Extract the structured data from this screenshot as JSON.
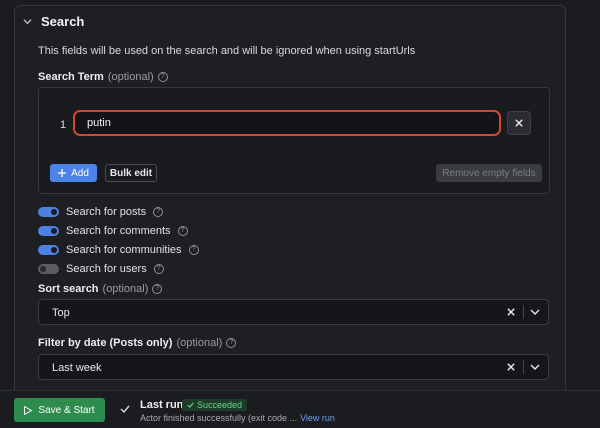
{
  "section": {
    "title": "Search",
    "description": "This fields will be used on the search and will be ignored when using startUrls"
  },
  "search_term": {
    "label": "Search Term",
    "optional": "(optional)",
    "rows": [
      {
        "index": "1",
        "value": "putin"
      }
    ],
    "add_label": "Add",
    "bulk_edit_label": "Bulk edit",
    "remove_empty_label": "Remove empty fields"
  },
  "toggles": [
    {
      "label": "Search for posts",
      "on": true
    },
    {
      "label": "Search for comments",
      "on": true
    },
    {
      "label": "Search for communities",
      "on": true
    },
    {
      "label": "Search for users",
      "on": false
    }
  ],
  "sort": {
    "label": "Sort search",
    "optional": "(optional)",
    "value": "Top"
  },
  "filter": {
    "label": "Filter by date (Posts only)",
    "optional": "(optional)",
    "value": "Last week"
  },
  "footer": {
    "save_label": "Save & Start",
    "last_run_title": "Last run",
    "status_badge": "Succeeded",
    "status_text": "Actor finished successfully (exit code ...",
    "view_run": "View run"
  },
  "colors": {
    "accent": "#4d82e8",
    "success": "#2e8c4e",
    "input_border": "#d4492b"
  },
  "icons": [
    "chevron-down-icon",
    "help-icon",
    "close-icon",
    "plus-icon",
    "play-icon",
    "check-icon"
  ]
}
